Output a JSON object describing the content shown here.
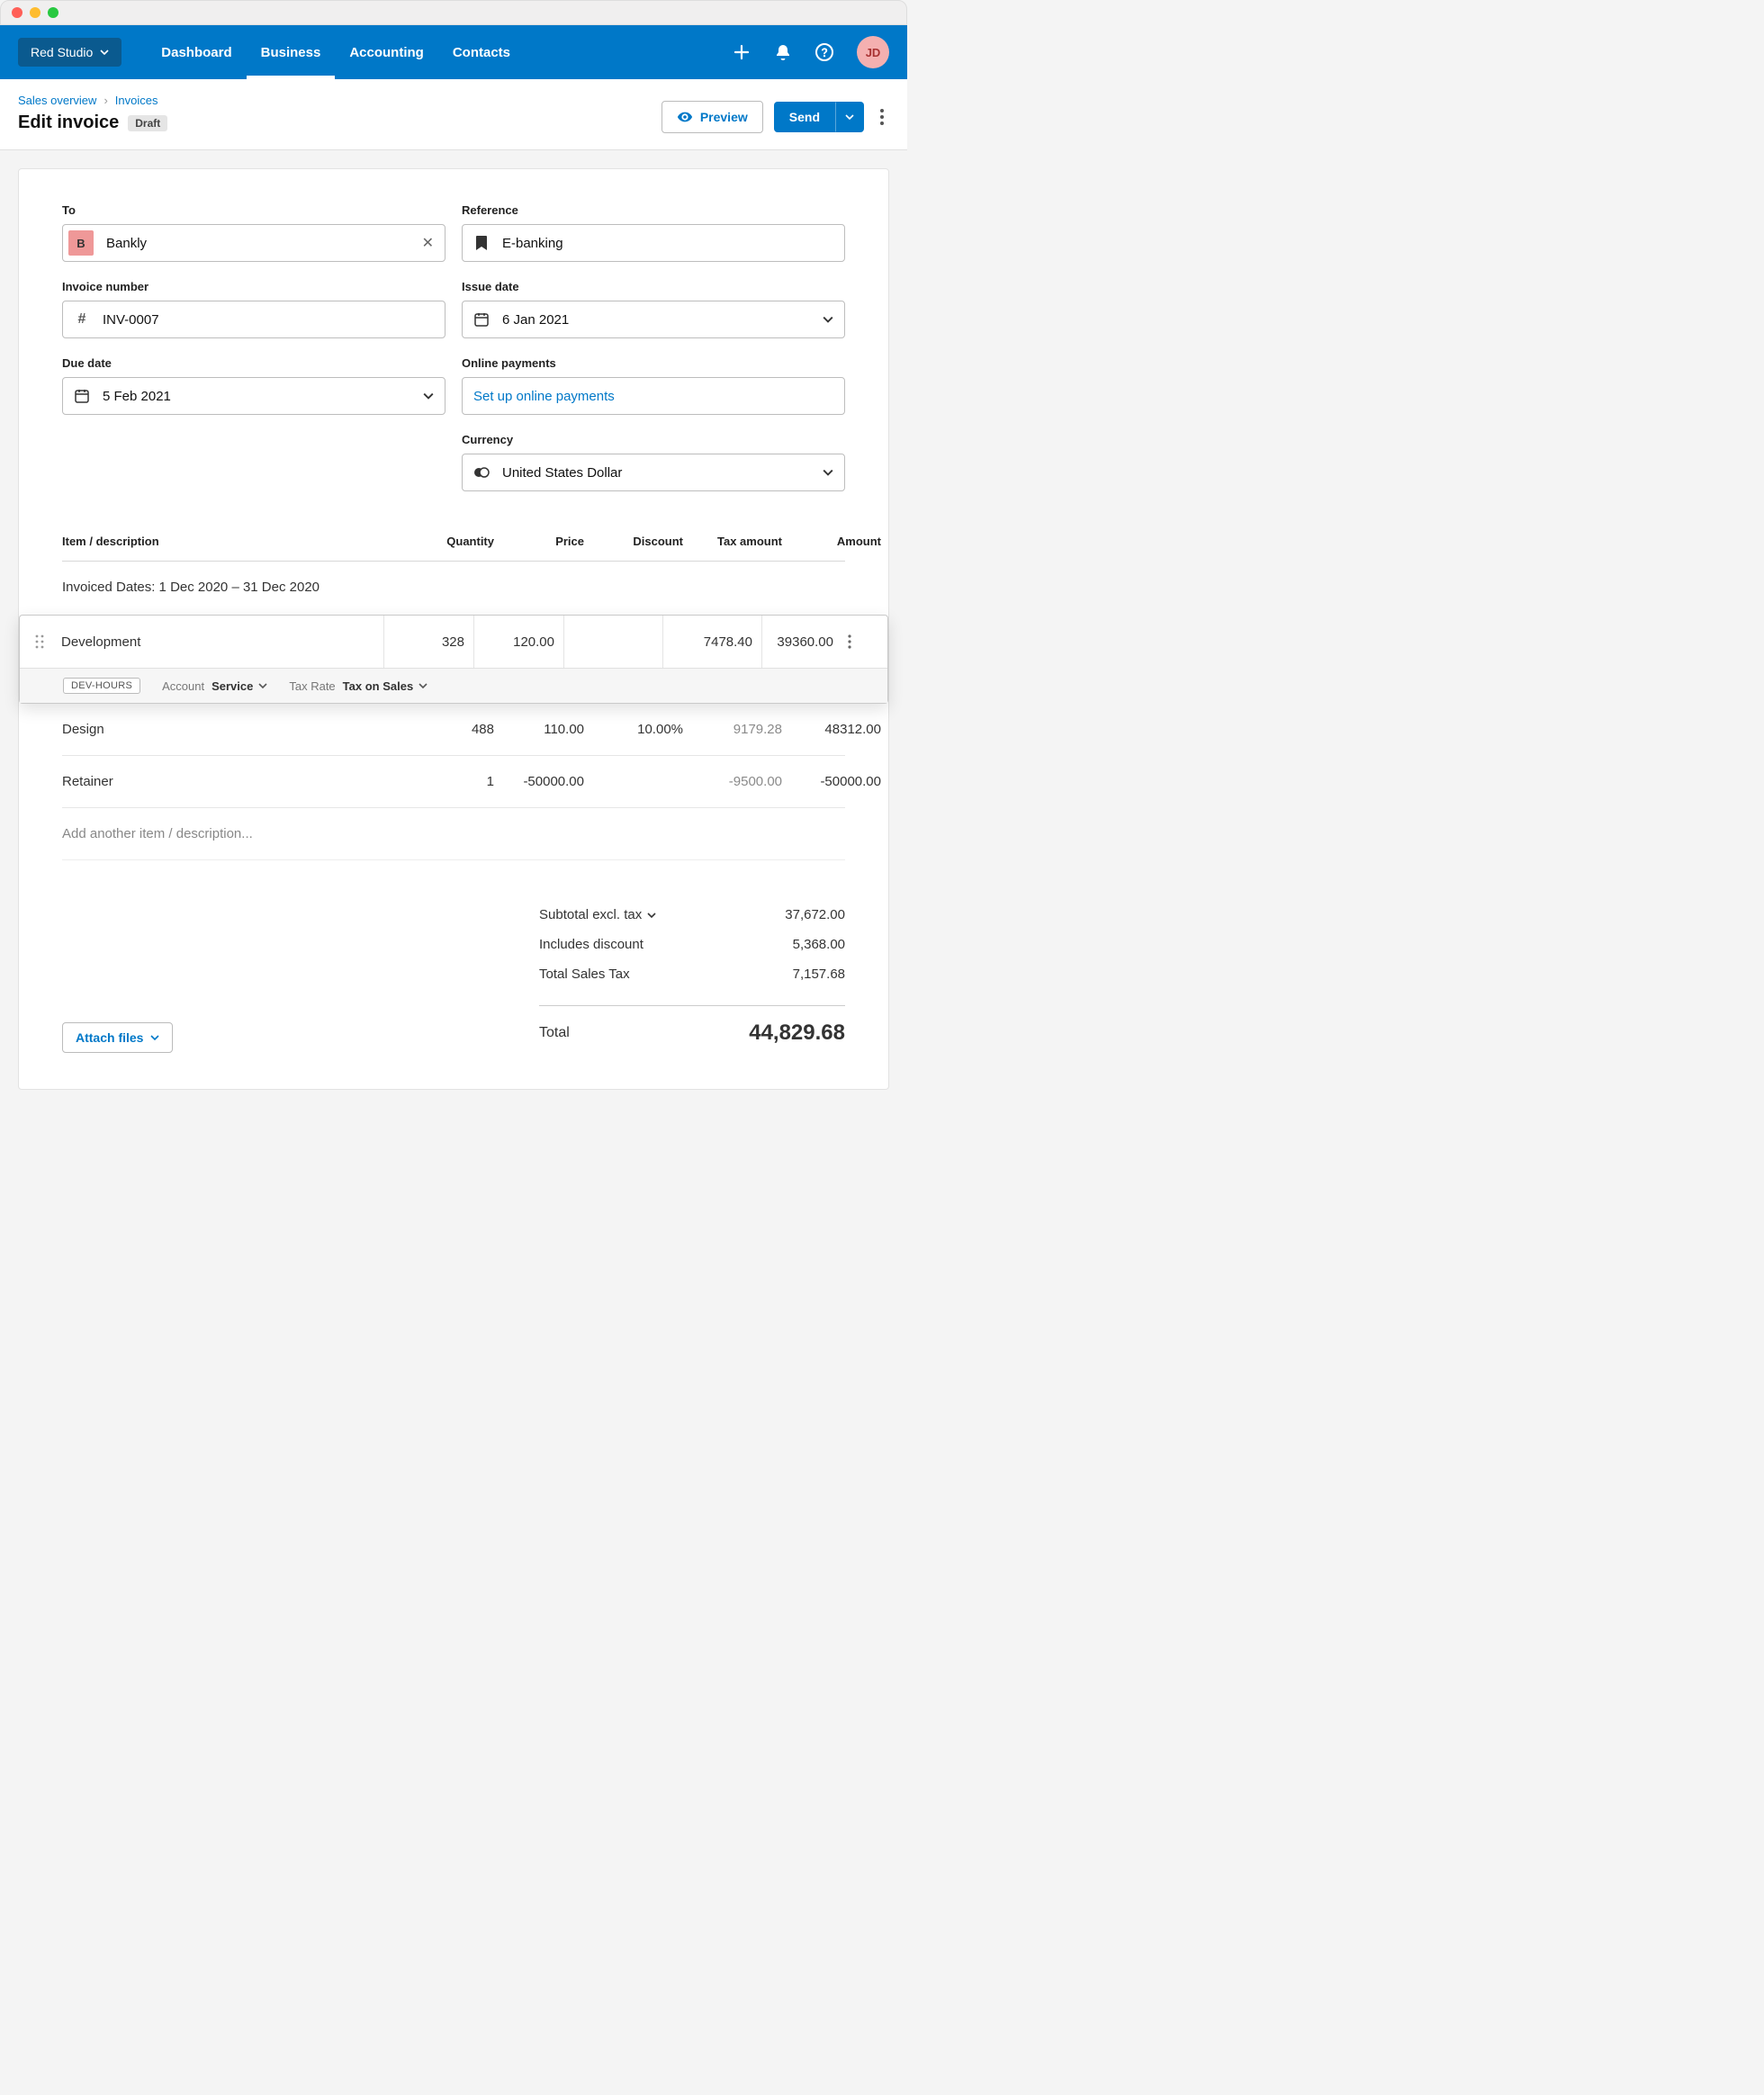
{
  "chrome": {},
  "nav": {
    "org": "Red Studio",
    "links": [
      "Dashboard",
      "Business",
      "Accounting",
      "Contacts"
    ],
    "active_index": 1,
    "avatar_initials": "JD"
  },
  "breadcrumbs": [
    "Sales overview",
    "Invoices"
  ],
  "page": {
    "title": "Edit invoice",
    "status": "Draft",
    "preview_label": "Preview",
    "send_label": "Send"
  },
  "form": {
    "to_label": "To",
    "to_avatar": "B",
    "to_value": "Bankly",
    "reference_label": "Reference",
    "reference_value": "E-banking",
    "invoice_no_label": "Invoice number",
    "invoice_no_value": "INV-0007",
    "issue_date_label": "Issue date",
    "issue_date_value": "6 Jan 2021",
    "due_date_label": "Due date",
    "due_date_value": "5 Feb 2021",
    "online_label": "Online payments",
    "online_value": "Set up online payments",
    "currency_label": "Currency",
    "currency_value": "United States Dollar"
  },
  "table": {
    "cols": [
      "Item / description",
      "Quantity",
      "Price",
      "Discount",
      "Tax amount",
      "Amount"
    ],
    "invoiced_dates": "Invoiced Dates: 1 Dec 2020 – 31 Dec 2020",
    "rows": [
      {
        "desc": "Development",
        "qty": "328",
        "price": "120.00",
        "discount": "",
        "tax": "7478.40",
        "amount": "39360.00",
        "selected": true,
        "meta": {
          "code": "DEV-HOURS",
          "account_label": "Account",
          "account_value": "Service",
          "taxrate_label": "Tax Rate",
          "taxrate_value": "Tax on Sales"
        }
      },
      {
        "desc": "Design",
        "qty": "488",
        "price": "110.00",
        "discount": "10.00%",
        "tax": "9179.28",
        "amount": "48312.00"
      },
      {
        "desc": "Retainer",
        "qty": "1",
        "price": "-50000.00",
        "discount": "",
        "tax": "-9500.00",
        "amount": "-50000.00"
      }
    ],
    "placeholder": "Add another item / description..."
  },
  "totals": {
    "subtotal_label": "Subtotal excl. tax",
    "subtotal_value": "37,672.00",
    "discount_label": "Includes discount",
    "discount_value": "5,368.00",
    "tax_label": "Total Sales Tax",
    "tax_value": "7,157.68",
    "total_label": "Total",
    "total_value": "44,829.68"
  },
  "attach_label": "Attach files"
}
